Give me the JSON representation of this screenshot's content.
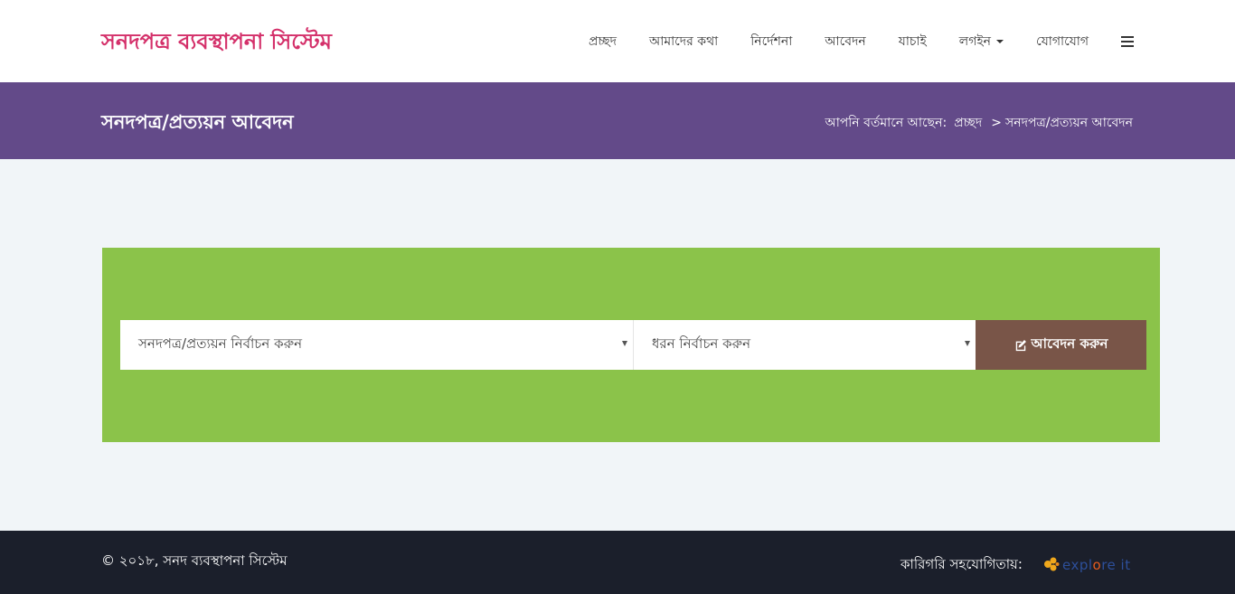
{
  "brand": {
    "title": "সনদপত্র ব্যবস্থাপনা সিস্টেম",
    "color": "#d4306a"
  },
  "nav": {
    "items": [
      {
        "label": "প্রচ্ছদ"
      },
      {
        "label": "আমাদের কথা"
      },
      {
        "label": "নির্দেশনা"
      },
      {
        "label": "আবেদন"
      },
      {
        "label": "যাচাই"
      },
      {
        "label": "লগইন"
      },
      {
        "label": "যোগাযোগ"
      }
    ],
    "menu_icon": "hamburger-menu-icon"
  },
  "page_header": {
    "title": "সনদপত্র/প্রত্যয়ন আবেদন",
    "background": "#634a89",
    "breadcrumb": {
      "prefix": "আপনি বর্তমানে আছেন:",
      "home": "প্রচ্ছদ",
      "separator": ">",
      "current": "সনদপত্র/প্রত্যয়ন আবেদন"
    }
  },
  "apply_form": {
    "background": "#8bc34a",
    "certificate_select": {
      "selected": "সনদপত্র/প্রত্যয়ন নির্বাচন করুন"
    },
    "type_select": {
      "selected": "ধরন নির্বাচন করুন"
    },
    "submit": {
      "label": "আবেদন করুন",
      "icon": "edit-icon",
      "color": "#795548"
    }
  },
  "footer": {
    "copyright": "© ২০১৮,  সনদ ব্যবস্থাপনা সিস্টেম",
    "credit_label": "কারিগরি সহযোগিতায়:",
    "partner": {
      "text_before": "expl",
      "text_o": "o",
      "text_after": "re it",
      "icon": "explore-it-logo-icon"
    },
    "background": "#1b1f2b"
  }
}
